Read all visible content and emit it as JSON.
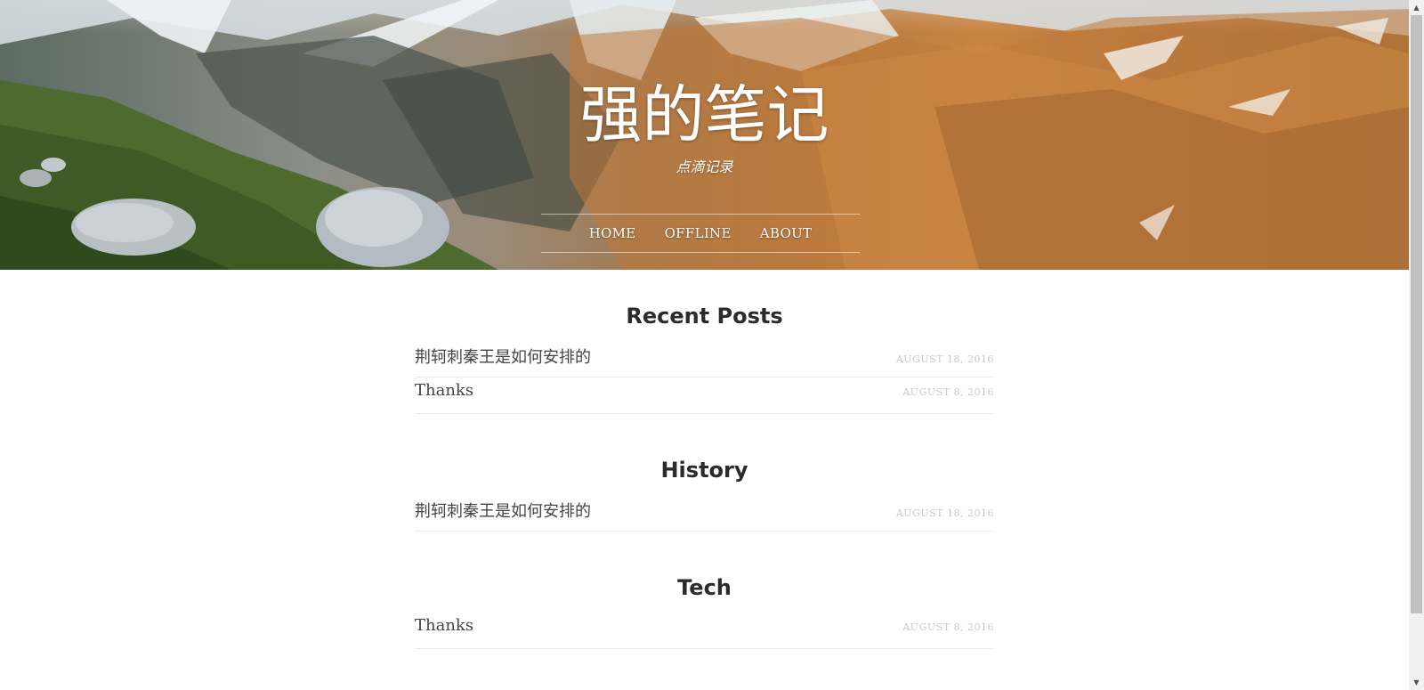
{
  "header": {
    "title": "强的笔记",
    "subtitle": "点滴记录",
    "nav": [
      {
        "label": "HOME"
      },
      {
        "label": "OFFLINE"
      },
      {
        "label": "ABOUT"
      }
    ]
  },
  "sections": [
    {
      "heading": "Recent Posts",
      "posts": [
        {
          "title": "荆轲刺秦王是如何安排的",
          "date": "AUGUST 18, 2016"
        },
        {
          "title": "Thanks",
          "date": "AUGUST 8, 2016"
        }
      ]
    },
    {
      "heading": "History",
      "posts": [
        {
          "title": "荆轲刺秦王是如何安排的",
          "date": "AUGUST 18, 2016"
        }
      ]
    },
    {
      "heading": "Tech",
      "posts": [
        {
          "title": "Thanks",
          "date": "AUGUST 8, 2016"
        }
      ]
    }
  ],
  "scrollbar": {
    "up_icon": "chevron-up-icon",
    "down_icon": "chevron-down-icon"
  },
  "colors": {
    "heading": "#2b2b2b",
    "post_title": "#444444",
    "post_date": "#c9c9c9",
    "divider": "#ececec"
  }
}
